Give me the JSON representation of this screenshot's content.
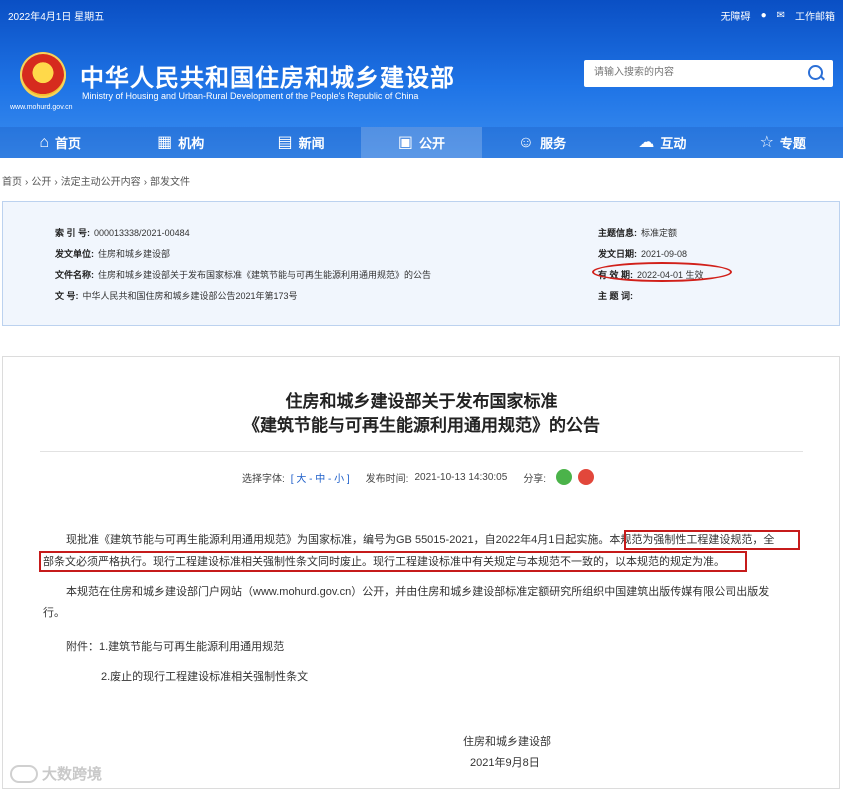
{
  "header": {
    "date": "2022年4月1日 星期五",
    "links": [
      "无障碍",
      "工作邮箱"
    ],
    "title_cn": "中华人民共和国住房和城乡建设部",
    "title_en": "Ministry of Housing and Urban-Rural Development of the People's Republic of China",
    "domain": "www.mohurd.gov.cn",
    "search_placeholder": "请输入搜索的内容"
  },
  "nav": [
    {
      "label": "首页",
      "icon": "⌂"
    },
    {
      "label": "机构",
      "icon": "▦"
    },
    {
      "label": "新闻",
      "icon": "▤"
    },
    {
      "label": "公开",
      "icon": "▣"
    },
    {
      "label": "服务",
      "icon": "☺"
    },
    {
      "label": "互动",
      "icon": "☁"
    },
    {
      "label": "专题",
      "icon": "☆"
    }
  ],
  "breadcrumb": [
    "首页",
    "›",
    "公开",
    "›",
    "法定主动公开内容",
    "›",
    "部发文件"
  ],
  "info": {
    "index_label": "索 引 号:",
    "index_value": "000013338/2021-00484",
    "issuer_label": "发文单位:",
    "issuer_value": "住房和城乡建设部",
    "filename_label": "文件名称:",
    "filename_value": "住房和城乡建设部关于发布国家标准《建筑节能与可再生能源利用通用规范》的公告",
    "docno_label": "文 号:",
    "docno_value": "中华人民共和国住房和城乡建设部公告2021年第173号",
    "topic_label": "主题信息:",
    "topic_value": "标准定额",
    "date_label": "发文日期:",
    "date_value": "2021-09-08",
    "valid_label": "有 效 期:",
    "valid_value": "2022-04-01 生效",
    "keywords_label": "主 题 词:",
    "keywords_value": ""
  },
  "article": {
    "title_line1": "住房和城乡建设部关于发布国家标准",
    "title_line2": "《建筑节能与可再生能源利用通用规范》的公告",
    "font_label": "选择字体:",
    "font_options": "[ 大 - 中 - 小 ]",
    "publish_label": "发布时间:",
    "publish_time": "2021-10-13 14:30:05",
    "share_label": "分享:",
    "p1_line1": "现批准《建筑节能与可再生能源利用通用规范》为国家标准，编号为GB 55015-2021，自2022年4月1日起实施。本规范为强制性工程建设规范，全",
    "p1_line2": "部条文必须严格执行。现行工程建设标准相关强制性条文同时废止。现行工程建设标准中有关规定与本规范不一致的，以本规范的规定为准。",
    "p2_line1": "本规范在住房和城乡建设部门户网站（www.mohurd.gov.cn）公开，并由住房和城乡建设部标准定额研究所组织中国建筑出版传媒有限公司出版发",
    "p2_line2": "行。",
    "attach1": "附件：1.建筑节能与可再生能源利用通用规范",
    "attach2": "2.废止的现行工程建设标准相关强制性条文",
    "sign_org": "住房和城乡建设部",
    "sign_date": "2021年9月8日"
  },
  "watermark": "大数跨境",
  "colors": {
    "header_blue": "#1f74e6",
    "highlight_red": "#c61b1b",
    "info_bg": "#f1f6fd"
  }
}
